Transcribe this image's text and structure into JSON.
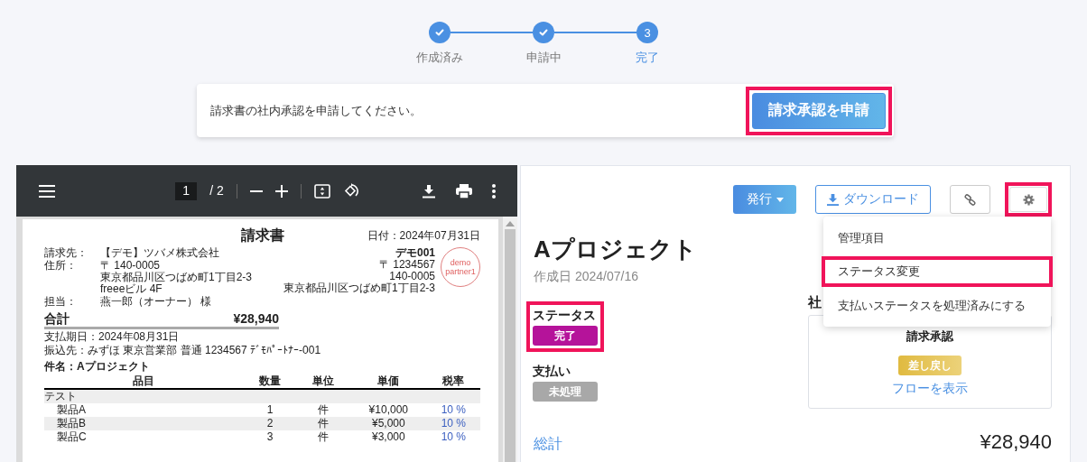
{
  "steps": [
    {
      "label": "作成済み",
      "completed": true,
      "selected": false
    },
    {
      "label": "申請中",
      "completed": true,
      "selected": false
    },
    {
      "label": "完了",
      "number": "3",
      "completed": false,
      "selected": true
    }
  ],
  "notice": {
    "message": "請求書の社内承認を申請してください。",
    "button": "請求承認を申請",
    "highlighted": true
  },
  "pdf_viewer": {
    "page": "1",
    "page_count": "/ 2",
    "document": {
      "title": "請求書",
      "date": "日付：2024年07月31日",
      "client_fields": [
        {
          "label": "請求先：",
          "lines": [
            "【デモ】ツバメ株式会社"
          ]
        },
        {
          "label": "住所：",
          "lines": [
            "〒 140-0005",
            "東京都品川区つばめ町1丁目2-3",
            "freeeビル 4F"
          ]
        },
        {
          "label": "担当：",
          "lines": [
            "燕一郎（オーナー） 様"
          ]
        }
      ],
      "issuer": {
        "name": "デモ001",
        "lines": [
          "〒 1234567",
          "140-0005",
          "東京都品川区つばめ町1丁目2-3"
        ],
        "stamp": [
          "demo",
          "partner1"
        ]
      },
      "total_label": "合計",
      "total": "¥28,940",
      "due": "支払期日：2024年08月31日",
      "bank": "振込先：みずほ 東京営業部 普通 1234567 ﾃﾞﾓﾊﾟｰﾄﾅｰ-001",
      "subject": "件名：Aプロジェクト",
      "table": {
        "columns": [
          "品目",
          "数量",
          "単位",
          "単価",
          "税率"
        ],
        "rows": [
          {
            "kind": "group",
            "cells": [
              "テスト"
            ]
          },
          {
            "kind": "item",
            "cells": [
              "製品A",
              "1",
              "件",
              "¥10,000",
              "10 %"
            ]
          },
          {
            "kind": "item",
            "cells": [
              "製品B",
              "2",
              "件",
              "¥5,000",
              "10 %"
            ]
          },
          {
            "kind": "item",
            "cells": [
              "製品C",
              "3",
              "件",
              "¥3,000",
              "10 %"
            ]
          }
        ]
      }
    }
  },
  "detail": {
    "actions": [
      {
        "kind": "dropdown",
        "label": "発行",
        "highlighted": false
      },
      {
        "kind": "download",
        "label": "ダウンロード",
        "highlighted": false
      },
      {
        "kind": "link",
        "highlighted": false
      },
      {
        "kind": "settings",
        "highlighted": true
      }
    ],
    "menu": [
      {
        "label": "管理項目",
        "highlighted": false
      },
      {
        "label": "ステータス変更",
        "highlighted": true
      },
      {
        "label": "支払いステータスを処理済みにする",
        "highlighted": false
      }
    ],
    "title": "Aプロジェクト",
    "created": "作成日 2024/07/16",
    "statuses": [
      {
        "label": "ステータス",
        "badge": "完了",
        "color": "#b5139a",
        "highlighted": true
      },
      {
        "label": "支払い",
        "badge": "未処理",
        "color": "#a8a8a8",
        "highlighted": false
      }
    ],
    "approval_heading": "社",
    "approval": {
      "title": "請求承認",
      "badge": "差し戻し",
      "link": "フローを表示"
    },
    "total_label": "総計",
    "total": "¥28,940"
  }
}
